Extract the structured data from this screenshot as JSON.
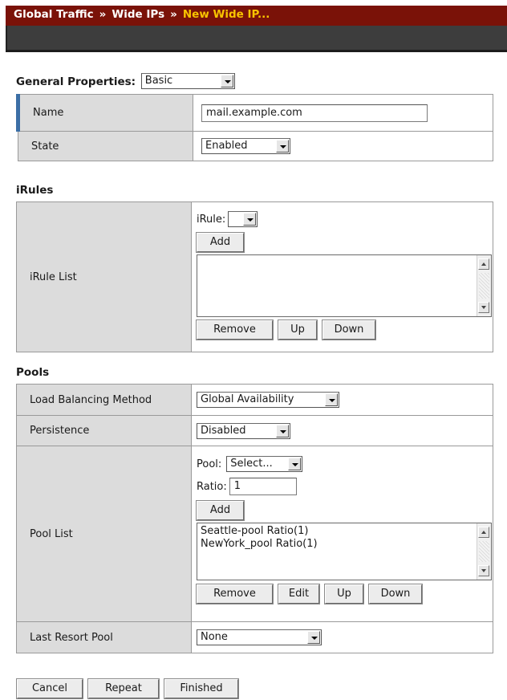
{
  "breadcrumb": {
    "items": [
      "Global Traffic",
      "Wide IPs"
    ],
    "separator": "»",
    "current": "New Wide IP..."
  },
  "general": {
    "title": "General Properties:",
    "mode": "Basic",
    "name_label": "Name",
    "name_value": "mail.example.com",
    "state_label": "State",
    "state_value": "Enabled"
  },
  "irules": {
    "title": "iRules",
    "list_label": "iRule List",
    "irule_label": "iRule:",
    "irule_value": "",
    "add": "Add",
    "remove": "Remove",
    "up": "Up",
    "down": "Down"
  },
  "pools": {
    "title": "Pools",
    "lb_label": "Load Balancing Method",
    "lb_value": "Global Availability",
    "persist_label": "Persistence",
    "persist_value": "Disabled",
    "list_label": "Pool List",
    "pool_label": "Pool:",
    "pool_value": "Select...",
    "ratio_label": "Ratio:",
    "ratio_value": "1",
    "add": "Add",
    "entries": [
      "Seattle-pool Ratio(1)",
      "NewYork_pool Ratio(1)"
    ],
    "remove": "Remove",
    "edit": "Edit",
    "up": "Up",
    "down": "Down",
    "last_label": "Last Resort Pool",
    "last_value": "None"
  },
  "footer": {
    "cancel": "Cancel",
    "repeat": "Repeat",
    "finished": "Finished"
  },
  "colors": {
    "header": "#7a1208",
    "breadcrumb_current": "#f8c400",
    "strip": "#3d3d3d",
    "label_bg": "#dcdcdc",
    "name_accent": "#3c6fa6"
  }
}
